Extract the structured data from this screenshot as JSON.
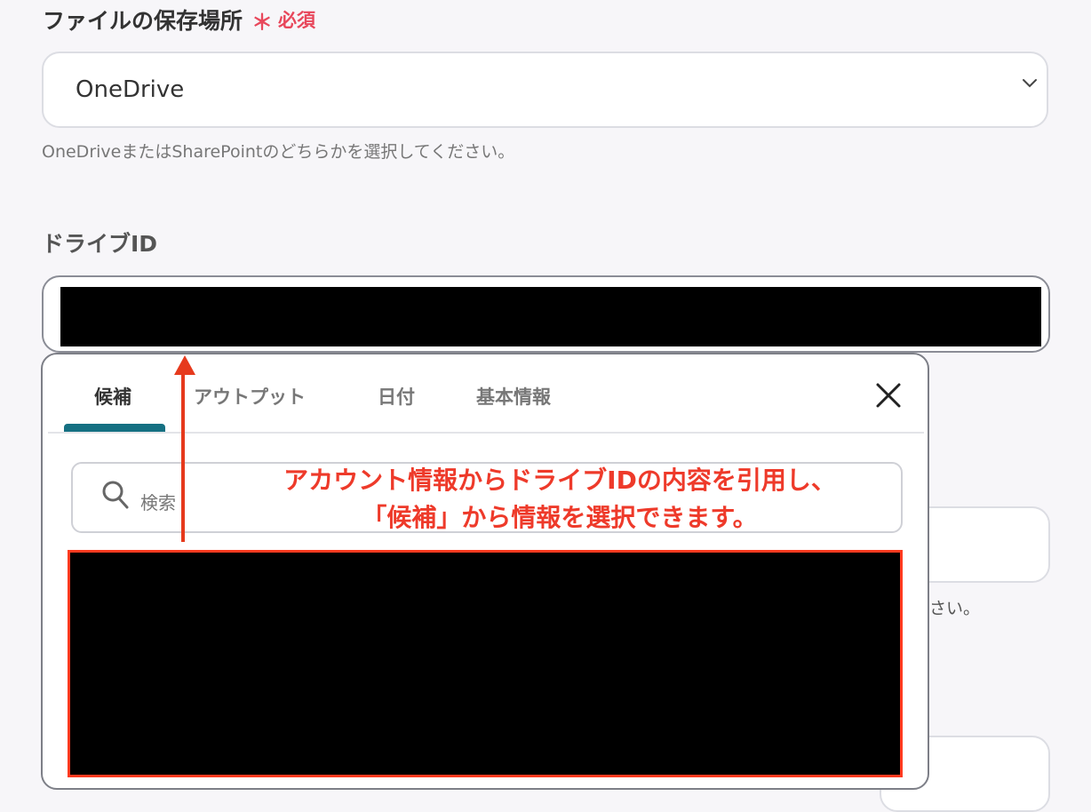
{
  "storage_field": {
    "label": "ファイルの保存場所",
    "required_mark": "＊",
    "required_text": "必須",
    "value": "OneDrive",
    "help": "OneDriveまたはSharePointのどちらかを選択してください。"
  },
  "drive_id_field": {
    "label": "ドライブID"
  },
  "background": {
    "help_fragment": "さい。"
  },
  "picker": {
    "tabs": [
      "候補",
      "アウトプット",
      "日付",
      "基本情報"
    ],
    "active_tab": "候補",
    "close_icon": "×",
    "search_placeholder": "検索"
  },
  "annotation": {
    "line1": "アカウント情報からドライブIDの内容を引用し、",
    "line2": "「候補」から情報を選択できます。"
  },
  "colors": {
    "required": "#e8475b",
    "tab_underline": "#157082",
    "annotation": "#ee3a2a"
  },
  "icons": [
    "chevron-down-icon",
    "close-icon",
    "search-icon",
    "arrow-up-icon"
  ]
}
